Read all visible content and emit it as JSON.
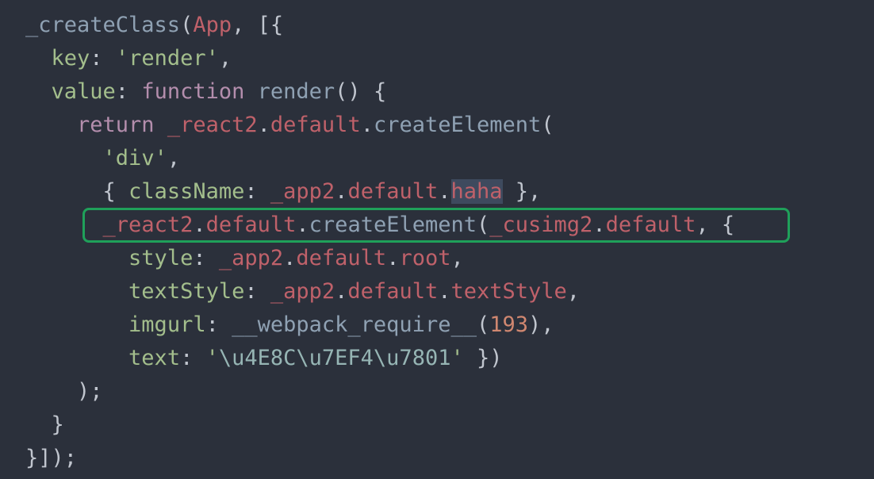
{
  "theme": {
    "background": "#2b303b",
    "default_text": "#c0c5ce",
    "function_color": "#8fa1b3",
    "object_color": "#bf616a",
    "keyword_color": "#b48ead",
    "string_color": "#a3be8c",
    "escape_color": "#96b5b4",
    "number_color": "#d08770",
    "highlight_box_color": "#1fa05a"
  },
  "code": {
    "l1": {
      "indent": "",
      "t1": "_createClass",
      "t2": "(",
      "t3": "App",
      "t4": ", [{"
    },
    "l2": {
      "indent": "  ",
      "t1": "key",
      "t2": ": ",
      "t3": "'render'",
      "t4": ","
    },
    "l3": {
      "indent": "  ",
      "t1": "value",
      "t2": ": ",
      "t3": "function",
      "t4": " ",
      "t5": "render",
      "t6": "() {"
    },
    "l4": {
      "indent": "    ",
      "t1": "return",
      "t2": " ",
      "t3": "_react2",
      "t4": ".",
      "t5": "default",
      "t6": ".",
      "t7": "createElement",
      "t8": "("
    },
    "l5": {
      "indent": "      ",
      "t1": "'div'",
      "t2": ","
    },
    "l6": {
      "indent": "      ",
      "t1": "{ ",
      "t2": "className",
      "t3": ": ",
      "t4": "_app2",
      "t5": ".",
      "t6": "default",
      "t7": ".",
      "t8": "haha",
      "t9": " },"
    },
    "l7": {
      "indent": "      ",
      "t1": "_react2",
      "t2": ".",
      "t3": "default",
      "t4": ".",
      "t5": "createElement",
      "t6": "(",
      "t7": "_cusimg2",
      "t8": ".",
      "t9": "default",
      "t10": ", {"
    },
    "l8": {
      "indent": "        ",
      "t1": "style",
      "t2": ": ",
      "t3": "_app2",
      "t4": ".",
      "t5": "default",
      "t6": ".",
      "t7": "root",
      "t8": ","
    },
    "l9": {
      "indent": "        ",
      "t1": "textStyle",
      "t2": ": ",
      "t3": "_app2",
      "t4": ".",
      "t5": "default",
      "t6": ".",
      "t7": "textStyle",
      "t8": ","
    },
    "l10": {
      "indent": "        ",
      "t1": "imgurl",
      "t2": ": ",
      "t3": "__webpack_require__",
      "t4": "(",
      "t5": "193",
      "t6": "),"
    },
    "l11": {
      "indent": "        ",
      "t1": "text",
      "t2": ": ",
      "t3": "'",
      "t4": "\\u4E8C\\u7EF4\\u7801",
      "t5": "'",
      "t6": " })"
    },
    "l12": {
      "indent": "    ",
      "t1": ");"
    },
    "l13": {
      "indent": "  ",
      "t1": "}"
    },
    "l14": {
      "indent": "",
      "t1": "}]);"
    }
  }
}
